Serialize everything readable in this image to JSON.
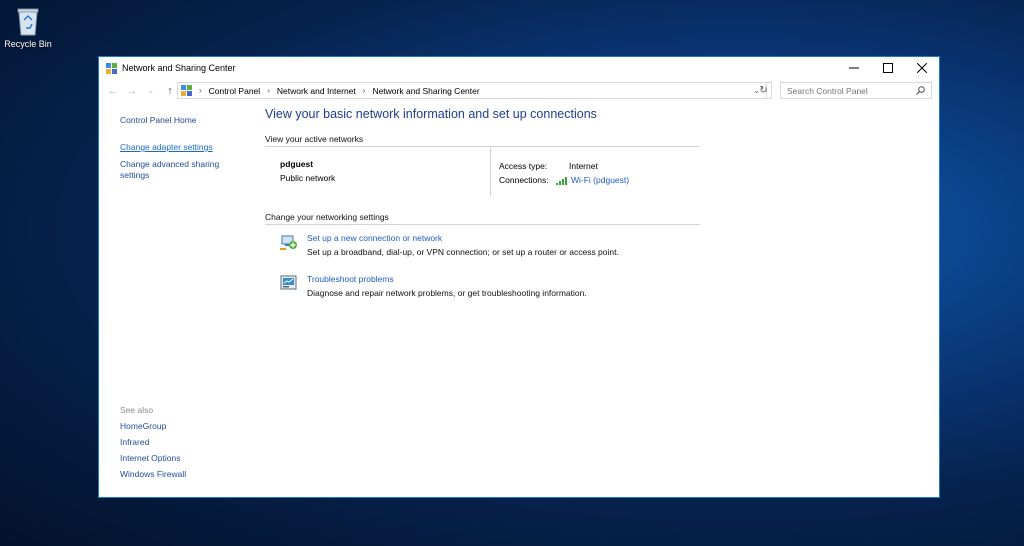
{
  "desktop": {
    "recycle_bin_label": "Recycle Bin"
  },
  "window": {
    "title": "Network and Sharing Center",
    "controls": {
      "minimize": "–",
      "maximize": "☐",
      "close": "✕"
    }
  },
  "address": {
    "breadcrumbs": [
      "Control Panel",
      "Network and Internet",
      "Network and Sharing Center"
    ],
    "search_placeholder": "Search Control Panel"
  },
  "left_pane": {
    "home": "Control Panel Home",
    "links": [
      "Change adapter settings",
      "Change advanced sharing settings"
    ],
    "see_also_header": "See also",
    "see_also": [
      "HomeGroup",
      "Infrared",
      "Internet Options",
      "Windows Firewall"
    ]
  },
  "main": {
    "heading": "View your basic network information and set up connections",
    "active_networks_title": "View your active networks",
    "network": {
      "name": "pdguest",
      "category": "Public network",
      "access_type_label": "Access type:",
      "access_type_value": "Internet",
      "connections_label": "Connections:",
      "connection_link": "Wi-Fi (pdguest)"
    },
    "change_settings_title": "Change your networking settings",
    "tasks": [
      {
        "link": "Set up a new connection or network",
        "description": "Set up a broadband, dial-up, or VPN connection; or set up a router or access point."
      },
      {
        "link": "Troubleshoot problems",
        "description": "Diagnose and repair network problems, or get troubleshooting information."
      }
    ]
  },
  "colors": {
    "link": "#1f5cc4",
    "heading": "#1e3d8f",
    "window_border": "#1f79c6"
  }
}
